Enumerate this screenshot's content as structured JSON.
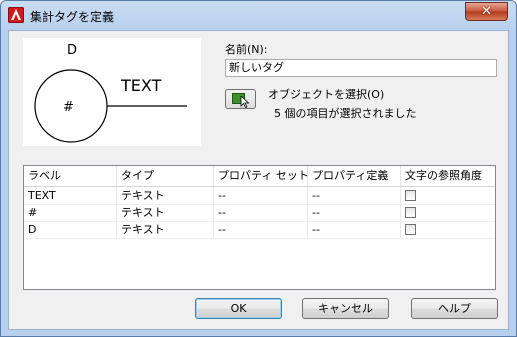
{
  "window": {
    "title": "集計タグを定義"
  },
  "titlebar": {
    "close_symbol": "✕"
  },
  "preview": {
    "top_label": "D",
    "center_label": "#",
    "side_label": "TEXT"
  },
  "name": {
    "label": "名前(N):",
    "value": "新しいタグ"
  },
  "select_objects": {
    "label": "オブジェクトを選択(O)",
    "status": "5 個の項目が選択されました"
  },
  "table": {
    "columns": [
      "ラベル",
      "タイプ",
      "プロパティ セット",
      "プロパティ定義",
      "文字の参照角度"
    ],
    "rows": [
      {
        "label": "TEXT",
        "type": "テキスト",
        "property_set": "--",
        "property_def": "--",
        "text_angle": false
      },
      {
        "label": "#",
        "type": "テキスト",
        "property_set": "--",
        "property_def": "--",
        "text_angle": false
      },
      {
        "label": "D",
        "type": "テキスト",
        "property_set": "--",
        "property_def": "--",
        "text_angle": false
      }
    ]
  },
  "buttons": {
    "ok": "OK",
    "cancel": "キャンセル",
    "help": "ヘルプ"
  },
  "colors": {
    "title_gradient": "#c9dcf2",
    "close_button": "#c7573b",
    "select_icon": "#3f8f2c"
  }
}
